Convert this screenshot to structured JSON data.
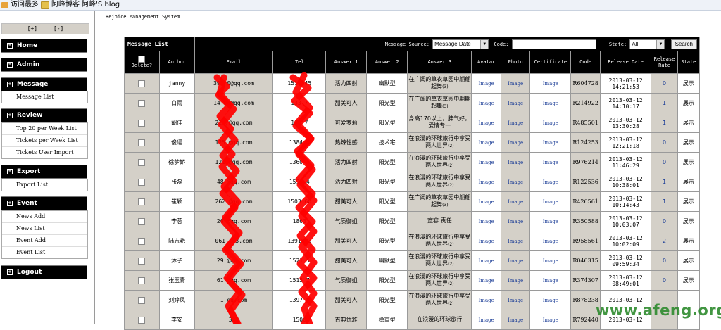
{
  "bookmarks": [
    {
      "label": "访问最多",
      "icon": "star-icon"
    },
    {
      "label": "阿峰博客 阿峰'S blog",
      "icon": "folder-icon"
    }
  ],
  "sidebar": {
    "toggle_expand": "[+]",
    "toggle_collapse": "[-]",
    "menus": [
      {
        "title": "Home",
        "items": []
      },
      {
        "title": "Admin",
        "items": []
      },
      {
        "title": "Message",
        "items": [
          "Message List"
        ]
      },
      {
        "title": "Review",
        "items": [
          "Top 20 per Week List",
          "Tickets per Week List",
          "Tickets User Import"
        ]
      },
      {
        "title": "Export",
        "items": [
          "Export List"
        ]
      },
      {
        "title": "Event",
        "items": [
          "News Add",
          "News List",
          "Event Add",
          "Event List"
        ]
      },
      {
        "title": "Logout",
        "items": []
      }
    ]
  },
  "main": {
    "site_title": "Rejoice Management System",
    "list_title": "Message List",
    "toolbar": {
      "source_label": "Message Source:",
      "source_value": "Message Date",
      "code_label": "Code:",
      "code_value": "",
      "state_label": "State:",
      "state_value": "All",
      "search_label": "Search"
    },
    "columns": [
      "Delete?",
      "Author",
      "Email",
      "Tel",
      "Answer 1",
      "Answer 2",
      "Answer 3",
      "Avatar",
      "Photo",
      "Certificate",
      "Code",
      "Release Date",
      "Release Rate",
      "State"
    ],
    "link_text": "Image",
    "rows": [
      {
        "author": "janny",
        "email": "391   0@qq.com",
        "tel": "151   345",
        "a1": "活力四射",
        "a2": "幽默型",
        "a3": "在广阔的草衣草园中翩翩起舞",
        "a3n": "(3)",
        "code": "R604728",
        "date": "2013-03-12",
        "time": "14:21:53",
        "rate": "0",
        "state": "展示"
      },
      {
        "author": "白雨",
        "email": "14   00@qq.com",
        "tel": "133   7",
        "a1": "甜美可人",
        "a2": "阳光型",
        "a3": "在广阔的草衣草园中翩翩起舞",
        "a3n": "(3)",
        "code": "R214922",
        "date": "2013-03-12",
        "time": "14:10:17",
        "rate": "1",
        "state": "展示"
      },
      {
        "author": "胡佳",
        "email": "22   7@qq.com",
        "tel": "186   7",
        "a1": "可爱萝莉",
        "a2": "阳光型",
        "a3": "身高170以上，脾气好，爱情专一",
        "a3n": "",
        "code": "R485501",
        "date": "2013-03-12",
        "time": "13:30:28",
        "rate": "1",
        "state": "展示"
      },
      {
        "author": "俊逼",
        "email": "125   @qq.com",
        "tel": "1384   4",
        "a1": "热辣性感",
        "a2": "技术宅",
        "a3": "在浪漫的环球旅行中享受两人世界",
        "a3n": "(2)",
        "code": "R124253",
        "date": "2013-03-12",
        "time": "12:21:18",
        "rate": "0",
        "state": "展示"
      },
      {
        "author": "徐梦娇",
        "email": "121   @qq.com",
        "tel": "1360   4",
        "a1": "活力四射",
        "a2": "阳光型",
        "a3": "在浪漫的环球旅行中享受两人世界",
        "a3n": "(2)",
        "code": "R976214",
        "date": "2013-03-12",
        "time": "11:46:29",
        "rate": "0",
        "state": "展示"
      },
      {
        "author": "张磊",
        "email": "48   @qq.com",
        "tel": "1596   4",
        "a1": "活力四射",
        "a2": "阳光型",
        "a3": "在浪漫的环球旅行中享受两人世界",
        "a3n": "(2)",
        "code": "R122536",
        "date": "2013-03-12",
        "time": "10:38:01",
        "rate": "1",
        "state": "展示"
      },
      {
        "author": "崔颖",
        "email": "262   @qq.com",
        "tel": "1503   60",
        "a1": "甜美可人",
        "a2": "阳光型",
        "a3": "在广阔的草衣草园中翩翩起舞",
        "a3n": "(3)",
        "code": "R426561",
        "date": "2013-03-12",
        "time": "10:14:43",
        "rate": "1",
        "state": "展示"
      },
      {
        "author": "李蓉",
        "email": "26   @qq.com",
        "tel": "1863   ",
        "a1": "气质御姐",
        "a2": "阳光型",
        "a3": "宽容 责任",
        "a3n": "",
        "code": "R350588",
        "date": "2013-03-12",
        "time": "10:03:07",
        "rate": "0",
        "state": "展示"
      },
      {
        "author": "陆志艳",
        "email": "061   163.com",
        "tel": "13915   3",
        "a1": "甜美可人",
        "a2": "阳光型",
        "a3": "在浪漫的环球旅行中享受两人世界",
        "a3n": "(2)",
        "code": "R958561",
        "date": "2013-03-12",
        "time": "10:02:09",
        "rate": "2",
        "state": "展示"
      },
      {
        "author": "沐子",
        "email": "29   @qq.com",
        "tel": "1521   5",
        "a1": "甜美可人",
        "a2": "幽默型",
        "a3": "在浪漫的环球旅行中享受两人世界",
        "a3n": "(2)",
        "code": "R046315",
        "date": "2013-03-12",
        "time": "09:59:34",
        "rate": "0",
        "state": "展示"
      },
      {
        "author": "张玉青",
        "email": "61   @qq.com",
        "tel": "1515   7",
        "a1": "气质御姐",
        "a2": "阳光型",
        "a3": "在浪漫的环球旅行中享受两人世界",
        "a3n": "(2)",
        "code": "R374307",
        "date": "2013-03-12",
        "time": "08:49:01",
        "rate": "0",
        "state": "展示"
      },
      {
        "author": "刘婷凤",
        "email": "1   qq.com",
        "tel": "1397   9",
        "a1": "甜美可人",
        "a2": "阳光型",
        "a3": "在浪漫的环球旅行中享受两人世界",
        "a3n": "(2)",
        "code": "R878238",
        "date": "2013-03-12",
        "time": "",
        "rate": "",
        "state": ""
      },
      {
        "author": "李安",
        "email": "329   ",
        "tel": "1500   ",
        "a1": "古典优雅",
        "a2": "稳重型",
        "a3": "在浪漫的环球旅行",
        "a3n": "",
        "code": "R792440",
        "date": "2013-03-12",
        "time": "",
        "rate": "",
        "state": ""
      }
    ]
  },
  "watermark": "www.afeng.org",
  "colors": {
    "header_bg": "#000000",
    "gray_cell": "#d4d0c8",
    "link": "#1a3c96",
    "watermark": "#2e8b2e",
    "scribble": "#ff0000"
  }
}
